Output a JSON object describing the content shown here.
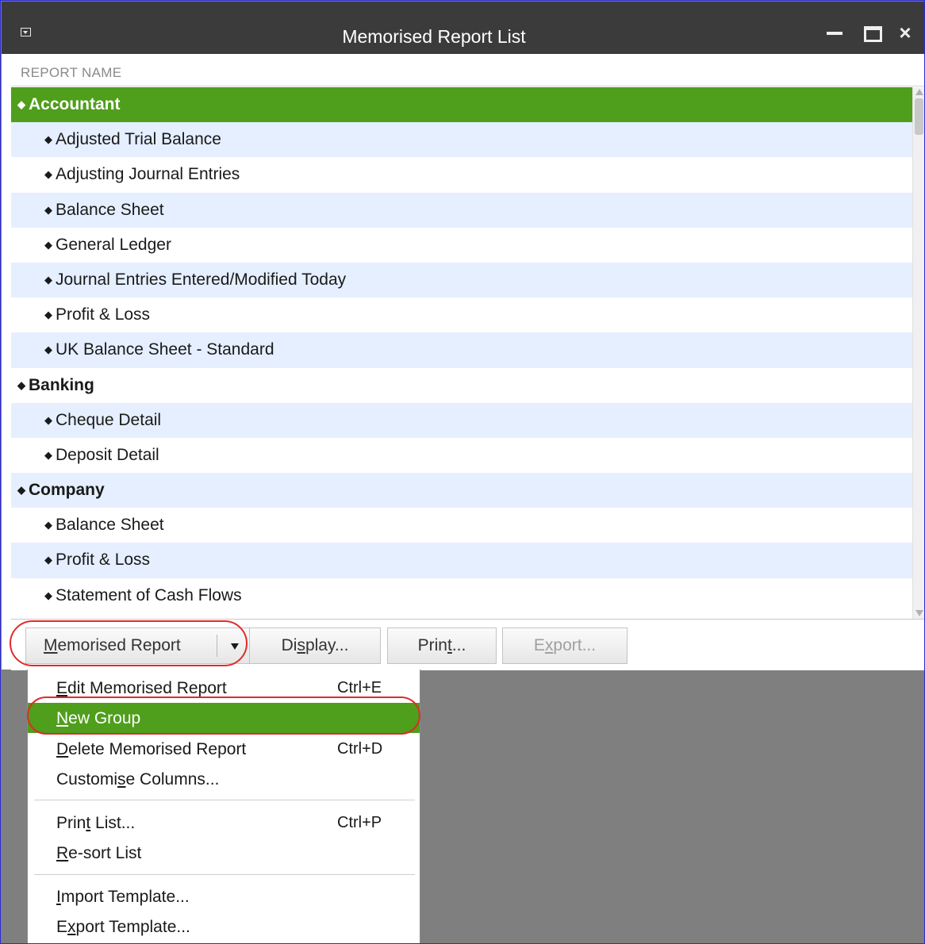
{
  "window": {
    "title": "Memorised Report List",
    "close_glyph": "×",
    "column_header": "REPORT NAME"
  },
  "rows": [
    {
      "label": "Accountant",
      "kind": "group",
      "selected": true
    },
    {
      "label": "Adjusted Trial Balance",
      "kind": "item"
    },
    {
      "label": "Adjusting Journal Entries",
      "kind": "item"
    },
    {
      "label": "Balance Sheet",
      "kind": "item"
    },
    {
      "label": "General Ledger",
      "kind": "item"
    },
    {
      "label": "Journal Entries Entered/Modified Today",
      "kind": "item"
    },
    {
      "label": "Profit & Loss",
      "kind": "item"
    },
    {
      "label": "UK Balance Sheet - Standard",
      "kind": "item"
    },
    {
      "label": "Banking",
      "kind": "group"
    },
    {
      "label": "Cheque Detail",
      "kind": "item"
    },
    {
      "label": "Deposit Detail",
      "kind": "item"
    },
    {
      "label": "Company",
      "kind": "group"
    },
    {
      "label": "Balance Sheet",
      "kind": "item"
    },
    {
      "label": "Profit & Loss",
      "kind": "item"
    },
    {
      "label": "Statement of Cash Flows",
      "kind": "item"
    }
  ],
  "buttons": {
    "memorised_report": {
      "pre": "",
      "u": "M",
      "post": "emorised Report"
    },
    "display": {
      "pre": "Di",
      "u": "s",
      "post": "play..."
    },
    "print": {
      "pre": "Prin",
      "u": "t",
      "post": "..."
    },
    "export": {
      "pre": "E",
      "u": "x",
      "post": "port..."
    }
  },
  "menu": {
    "items": [
      {
        "pre": "",
        "u": "E",
        "post": "dit Memorised Report",
        "shortcut": "Ctrl+E"
      },
      {
        "pre": "",
        "u": "N",
        "post": "ew Group",
        "shortcut": "",
        "active": true
      },
      {
        "pre": "",
        "u": "D",
        "post": "elete Memorised Report",
        "shortcut": "Ctrl+D"
      },
      {
        "pre": "Customi",
        "u": "s",
        "post": "e Columns...",
        "shortcut": ""
      },
      {
        "pre": "Prin",
        "u": "t",
        "post": " List...",
        "shortcut": "Ctrl+P"
      },
      {
        "pre": "",
        "u": "R",
        "post": "e-sort List",
        "shortcut": ""
      },
      {
        "pre": "",
        "u": "I",
        "post": "mport Template...",
        "shortcut": ""
      },
      {
        "pre": "E",
        "u": "x",
        "post": "port Template...",
        "shortcut": ""
      }
    ]
  },
  "colors": {
    "selection_green": "#4f9e1c",
    "title_bar": "#3b3b3b",
    "row_alt": "#e5efff",
    "highlight_oval": "#e02b2b",
    "background": "#7f7f7f"
  }
}
